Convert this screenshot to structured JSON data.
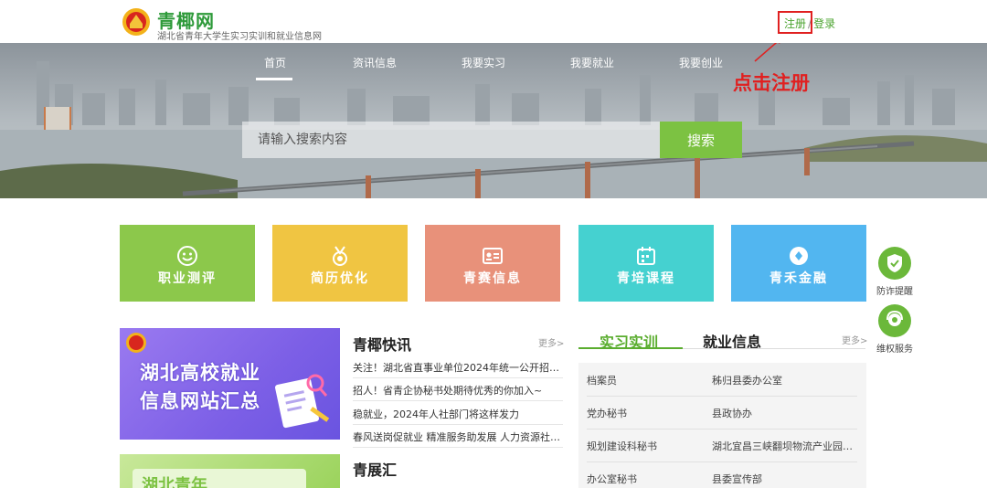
{
  "header": {
    "brand_title": "青椰网",
    "brand_subtitle": "湖北省青年大学生实习实训和就业信息网",
    "register": "注册",
    "separator": "/",
    "login": "登录"
  },
  "annotation": "点击注册",
  "nav": [
    "首页",
    "资讯信息",
    "我要实习",
    "我要就业",
    "我要创业"
  ],
  "search": {
    "placeholder": "请输入搜索内容",
    "button": "搜索"
  },
  "tiles": [
    {
      "label": "职业测评",
      "color": "#8cc84b",
      "icon": "smile-icon"
    },
    {
      "label": "简历优化",
      "color": "#f0c542",
      "icon": "medal-icon"
    },
    {
      "label": "青赛信息",
      "color": "#e8917a",
      "icon": "id-card-icon"
    },
    {
      "label": "青培课程",
      "color": "#45d1d0",
      "icon": "calendar-icon"
    },
    {
      "label": "青禾金融",
      "color": "#52b6f0",
      "icon": "diamond-icon"
    }
  ],
  "side_widgets": [
    {
      "label": "防诈提醒",
      "icon": "shield-check-icon"
    },
    {
      "label": "维权服务",
      "icon": "support-icon"
    }
  ],
  "promo": {
    "line1": "湖北高校就业",
    "line2": "信息网站汇总"
  },
  "promo2": {
    "text": "湖北青年"
  },
  "news": {
    "title": "青椰快讯",
    "more": "更多>",
    "items": [
      "关注！湖北省直事业单位2024年统一公开招聘120...",
      "招人！省青企协秘书处期待优秀的你加入~",
      "稳就业，2024年人社部门将这样发力",
      "春风送岗促就业 精准服务助发展 人力资源社会保..."
    ]
  },
  "expo": {
    "title": "青展汇"
  },
  "jobs_panel": {
    "tab_active": "实习实训",
    "tab_other": "就业信息",
    "more": "更多>",
    "rows": [
      {
        "position": "档案员",
        "org": "秭归县委办公室"
      },
      {
        "position": "党办秘书",
        "org": "县政协办"
      },
      {
        "position": "规划建设科秘书",
        "org": "湖北宜昌三峡翻坝物流产业园管..."
      },
      {
        "position": "办公室秘书",
        "org": "县委宣传部"
      }
    ]
  },
  "colors": {
    "brand_green": "#7cc242",
    "annotation_red": "#e02020",
    "promo_purple": "#7c5fe6"
  }
}
